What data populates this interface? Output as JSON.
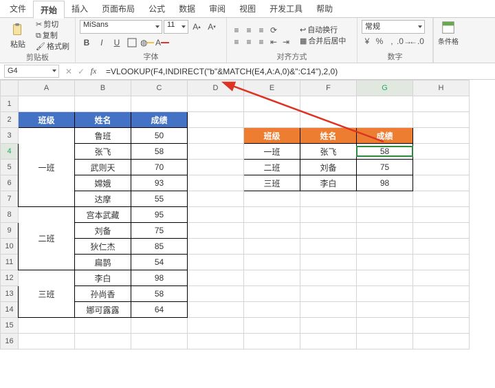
{
  "menu": {
    "file": "文件",
    "home": "开始",
    "insert": "插入",
    "layout": "页面布局",
    "formula": "公式",
    "data": "数据",
    "review": "审阅",
    "view": "视图",
    "dev": "开发工具",
    "help": "帮助"
  },
  "ribbon": {
    "clipboard": {
      "label": "剪贴板",
      "paste": "粘贴",
      "cut": "剪切",
      "copy": "复制",
      "painter": "格式刷"
    },
    "font": {
      "label": "字体",
      "name": "MiSans",
      "size": "11",
      "bold": "B",
      "italic": "I",
      "underline": "U"
    },
    "align": {
      "label": "对齐方式",
      "wrap": "自动换行",
      "merge": "合并后居中"
    },
    "number": {
      "label": "数字",
      "format": "常规",
      "percent": "%",
      "comma": ","
    },
    "cond": "条件格"
  },
  "namebox": "G4",
  "formula": "=VLOOKUP(F4,INDIRECT(\"b\"&MATCH(E4,A:A,0)&\":C14\"),2,0)",
  "cols": [
    "A",
    "B",
    "C",
    "D",
    "E",
    "F",
    "G",
    "H"
  ],
  "rows": [
    "1",
    "2",
    "3",
    "4",
    "5",
    "6",
    "7",
    "8",
    "9",
    "10",
    "11",
    "12",
    "13",
    "14",
    "15",
    "16"
  ],
  "left_header": {
    "class": "班级",
    "name": "姓名",
    "score": "成绩"
  },
  "left_data": [
    {
      "class": "一班",
      "rows": [
        [
          "鲁班",
          "50"
        ],
        [
          "张飞",
          "58"
        ],
        [
          "武则天",
          "70"
        ],
        [
          "嫦娥",
          "93"
        ],
        [
          "达摩",
          "55"
        ]
      ]
    },
    {
      "class": "二班",
      "rows": [
        [
          "宫本武藏",
          "95"
        ],
        [
          "刘备",
          "75"
        ],
        [
          "狄仁杰",
          "85"
        ],
        [
          "扁鹊",
          "54"
        ]
      ]
    },
    {
      "class": "三班",
      "rows": [
        [
          "李白",
          "98"
        ],
        [
          "孙尚香",
          "58"
        ],
        [
          "娜可露露",
          "64"
        ]
      ]
    }
  ],
  "right_header": {
    "class": "班级",
    "name": "姓名",
    "score": "成绩"
  },
  "right_data": [
    [
      "一班",
      "张飞",
      "58"
    ],
    [
      "二班",
      "刘备",
      "75"
    ],
    [
      "三班",
      "李白",
      "98"
    ]
  ],
  "active_cell": "G4"
}
